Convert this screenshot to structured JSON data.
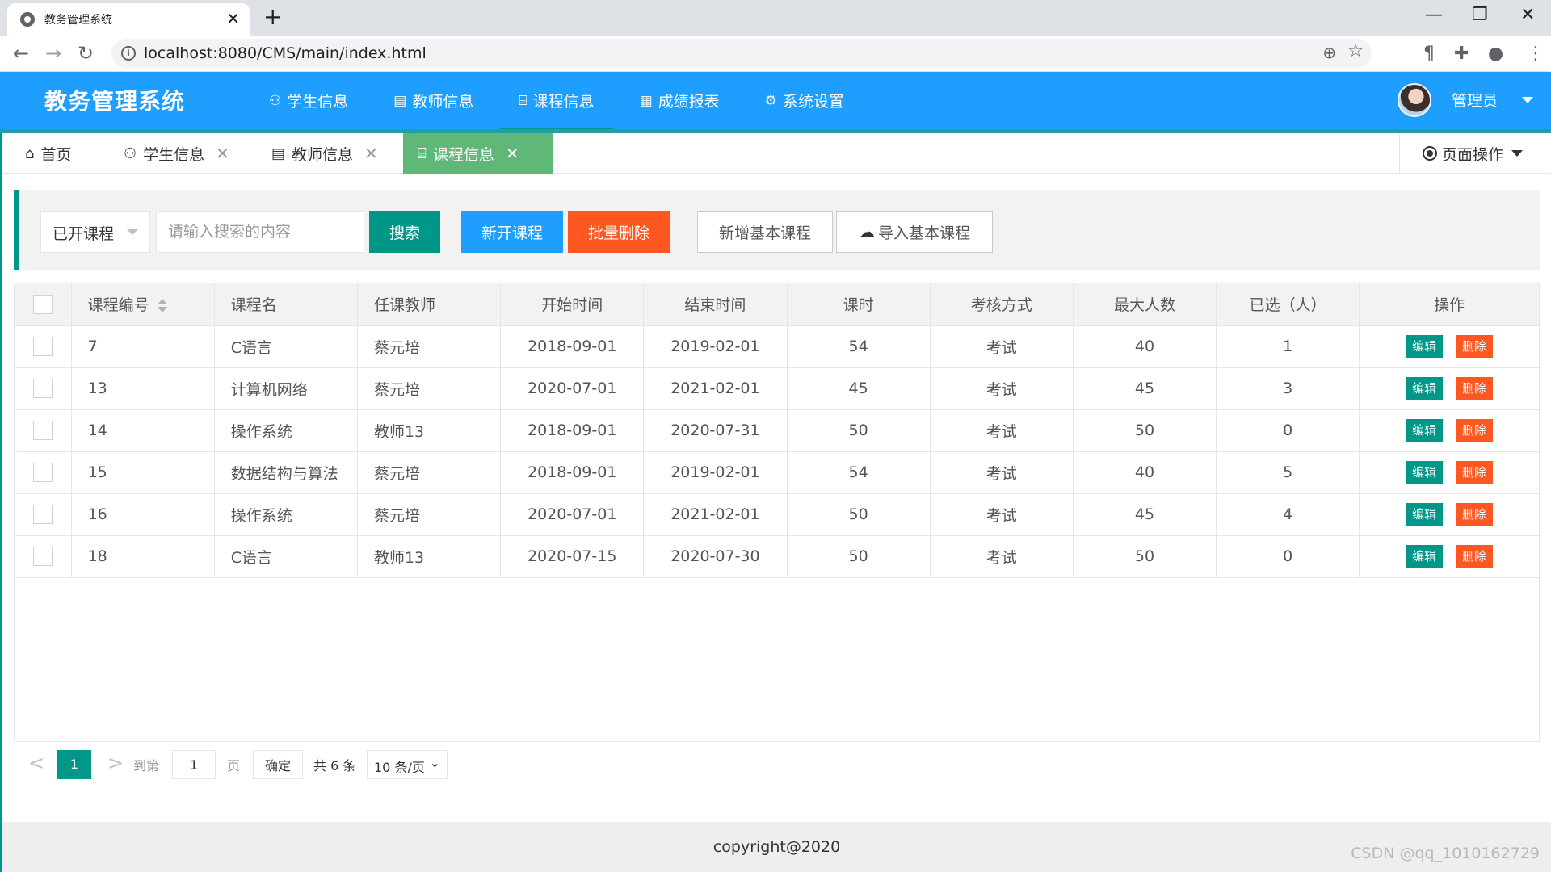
{
  "browser": {
    "tab_title": "教务管理系统",
    "close_glyph": "✕",
    "newtab_glyph": "+",
    "url": "localhost:8080/CMS/main/index.html",
    "controls": {
      "minimize": "—",
      "maximize": "❐",
      "close": "✕"
    },
    "nav": {
      "back": "←",
      "forward": "→",
      "reload": "↻"
    },
    "info_glyph": "i",
    "zoom_glyph": "⊕",
    "star_glyph": "☆",
    "toolbar_icons": {
      "ext1": "¶",
      "puzzle": "✚",
      "profile": "●",
      "menu": "⋮"
    }
  },
  "header": {
    "logo": "教务管理系统",
    "nav": [
      {
        "label": "学生信息",
        "icon": "users-icon",
        "glyph": "⚇"
      },
      {
        "label": "教师信息",
        "icon": "document-icon",
        "glyph": "▤"
      },
      {
        "label": "课程信息",
        "icon": "book-icon",
        "glyph": "⌸"
      },
      {
        "label": "成绩报表",
        "icon": "table-icon",
        "glyph": "▦"
      },
      {
        "label": "系统设置",
        "icon": "gear-icon",
        "glyph": "⚙"
      }
    ],
    "active_nav": "课程信息",
    "user": "管理员"
  },
  "page_tabs": {
    "items": [
      {
        "label": "首页",
        "glyph": "⌂",
        "closable": false
      },
      {
        "label": "学生信息",
        "glyph": "⚇",
        "closable": true
      },
      {
        "label": "教师信息",
        "glyph": "▤",
        "closable": true
      },
      {
        "label": "课程信息",
        "glyph": "⌸",
        "closable": true
      }
    ],
    "close_glyph": "✕",
    "active": "课程信息",
    "page_ops": "页面操作"
  },
  "search": {
    "select_value": "已开课程",
    "placeholder": "请输入搜索的内容",
    "search_btn": "搜索",
    "add_btn": "新开课程",
    "batch_delete_btn": "批量删除",
    "add_basic_btn": "新增基本课程",
    "import_btn": "导入基本课程",
    "cloud_glyph": "☁"
  },
  "table": {
    "headers": [
      "课程编号",
      "课程名",
      "任课教师",
      "开始时间",
      "结束时间",
      "课时",
      "考核方式",
      "最大人数",
      "已选（人）",
      "操作"
    ],
    "rows": [
      [
        "7",
        "C语言",
        "蔡元培",
        "2018-09-01",
        "2019-02-01",
        "54",
        "考试",
        "40",
        "1"
      ],
      [
        "13",
        "计算机网络",
        "蔡元培",
        "2020-07-01",
        "2021-02-01",
        "45",
        "考试",
        "45",
        "3"
      ],
      [
        "14",
        "操作系统",
        "教师13",
        "2018-09-01",
        "2020-07-31",
        "50",
        "考试",
        "50",
        "0"
      ],
      [
        "15",
        "数据结构与算法",
        "蔡元培",
        "2018-09-01",
        "2019-02-01",
        "54",
        "考试",
        "40",
        "5"
      ],
      [
        "16",
        "操作系统",
        "蔡元培",
        "2020-07-01",
        "2021-02-01",
        "50",
        "考试",
        "45",
        "4"
      ],
      [
        "18",
        "C语言",
        "教师13",
        "2020-07-15",
        "2020-07-30",
        "50",
        "考试",
        "50",
        "0"
      ]
    ],
    "edit_label": "编辑",
    "delete_label": "删除"
  },
  "pagination": {
    "prev_glyph": "<",
    "next_glyph": ">",
    "current": "1",
    "goto_label": "到第",
    "goto_value": "1",
    "page_label": "页",
    "ok": "确定",
    "total": "共 6 条",
    "page_size": "10 条/页",
    "size_chevron": "⌄"
  },
  "footer": "copyright@2020",
  "watermark": "CSDN @qq_1010162729",
  "colors": {
    "primary": "#1e9fff",
    "teal": "#009688",
    "orange": "#ff5722",
    "active_tab": "#5fb878"
  }
}
